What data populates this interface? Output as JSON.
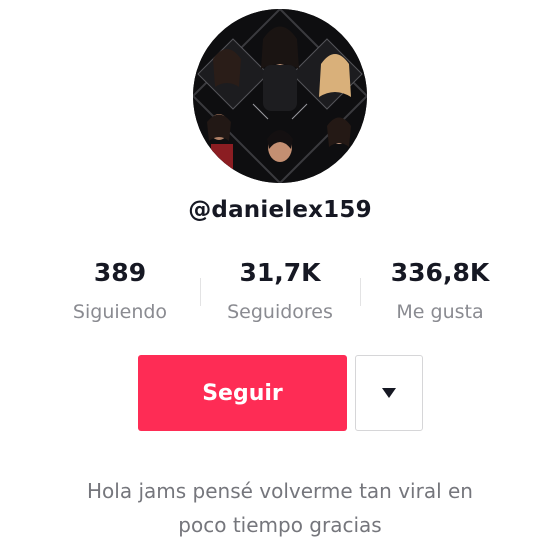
{
  "profile": {
    "avatar_alt": "profile photo",
    "username": "@danielex159",
    "bio_line1": "Hola jams pensé volverme tan viral en",
    "bio_line2": "poco tiempo gracias"
  },
  "stats": [
    {
      "value": "389",
      "label": "Siguiendo"
    },
    {
      "value": "31,7K",
      "label": "Seguidores"
    },
    {
      "value": "336,8K",
      "label": "Me gusta"
    }
  ],
  "actions": {
    "follow_label": "Seguir",
    "dropdown_icon": "caret-down-icon"
  },
  "colors": {
    "accent": "#fe2c55",
    "text_primary": "#161823",
    "text_secondary": "#8a8b91"
  }
}
